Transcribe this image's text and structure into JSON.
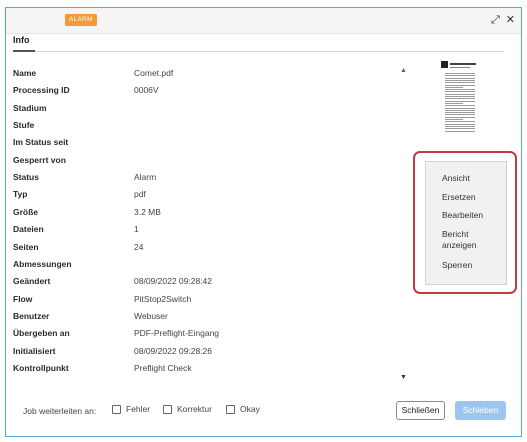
{
  "titlebar": {
    "badge": "ALARM",
    "expand_icon": "⤢",
    "close_icon": "✕"
  },
  "tab": {
    "label": "Info"
  },
  "properties": [
    {
      "label": "Name",
      "value": "Comet.pdf"
    },
    {
      "label": "Processing ID",
      "value": "0006V"
    },
    {
      "label": "Stadium",
      "value": ""
    },
    {
      "label": "Stufe",
      "value": ""
    },
    {
      "label": "Im Status seit",
      "value": ""
    },
    {
      "label": "Gesperrt von",
      "value": ""
    },
    {
      "label": "Status",
      "value": "Alarm"
    },
    {
      "label": "Typ",
      "value": "pdf"
    },
    {
      "label": "Größe",
      "value": "3.2 MB"
    },
    {
      "label": "Dateien",
      "value": "1"
    },
    {
      "label": "Seiten",
      "value": "24"
    },
    {
      "label": "Abmessungen",
      "value": ""
    },
    {
      "label": "Geändert",
      "value": "08/09/2022 09:28:42"
    },
    {
      "label": "Flow",
      "value": "PitStop2Switch"
    },
    {
      "label": "Benutzer",
      "value": "Webuser"
    },
    {
      "label": "Übergeben an",
      "value": "PDF-Preflight-Eingang"
    },
    {
      "label": "Initialisiert",
      "value": "08/09/2022 09:28:26"
    },
    {
      "label": "Kontrollpunkt",
      "value": "Preflight Check"
    }
  ],
  "context_menu": {
    "items": [
      "Ansicht",
      "Ersetzen",
      "Bearbeiten",
      "Bericht\nanzeigen",
      "Sperren"
    ]
  },
  "footer": {
    "forward_label": "Job weiterleiten an:",
    "checkboxes": [
      "Fehler",
      "Korrektur",
      "Okay"
    ],
    "close_button": "Schließen",
    "push_button": "Schieben"
  },
  "colors": {
    "badge": "#f59a3b",
    "window_border": "#59a5e0",
    "highlight": "#c03a3f",
    "push_button": "#9cc6ef"
  },
  "icons": {
    "expand": "expand-icon",
    "close": "close-icon",
    "scroll_up": "scroll-up-icon",
    "scroll_down": "scroll-down-icon"
  }
}
